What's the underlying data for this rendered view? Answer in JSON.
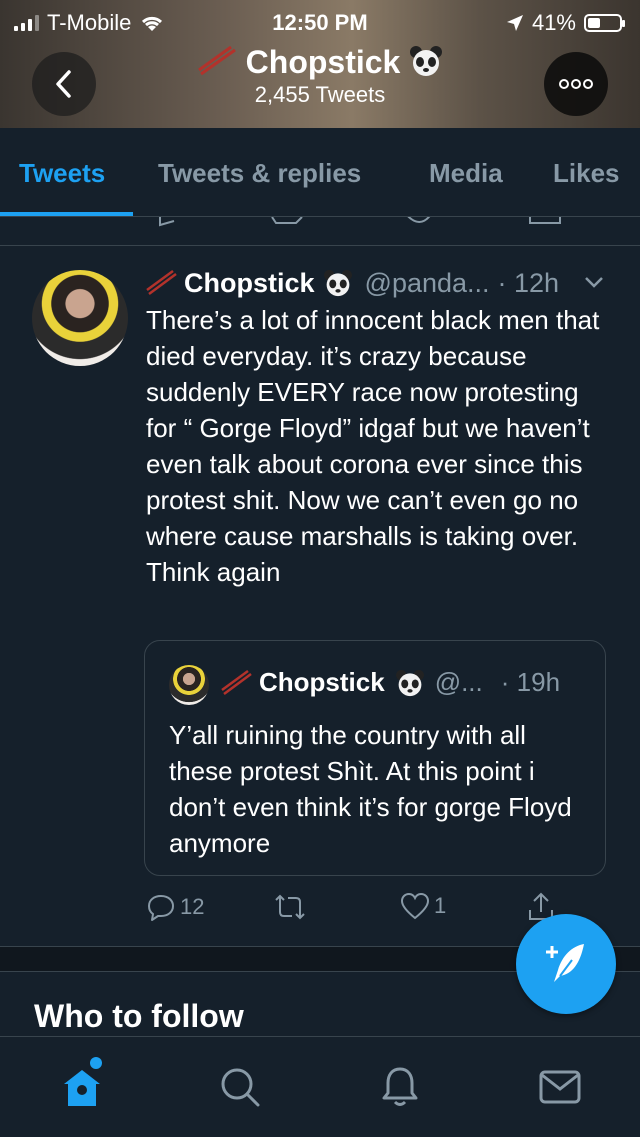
{
  "status_bar": {
    "carrier": "T-Mobile",
    "time": "12:50 PM",
    "battery_percent": "41%",
    "battery_level": 0.41
  },
  "header": {
    "title": "Chopstick",
    "tweet_count": "2,455 Tweets",
    "back_icon": "chevron-left-icon",
    "more_icon": "more-horizontal-icon"
  },
  "tabs": [
    {
      "label": "Tweets",
      "active": true
    },
    {
      "label": "Tweets & replies",
      "active": false
    },
    {
      "label": "Media",
      "active": false
    },
    {
      "label": "Likes",
      "active": false
    }
  ],
  "tweet": {
    "name": "Chopstick",
    "handle": "@panda...",
    "time": "· 12h",
    "text": "There’s a lot of innocent black men that died everyday. it’s crazy because suddenly EVERY race now protesting for “ Gorge Floyd” idgaf but we haven’t even talk about corona ever since this protest shit. Now we can’t even go no where cause marshalls is taking over. Think again",
    "quoted": {
      "name": "Chopstick",
      "handle": "@...",
      "time": "· 19h",
      "text": "Y’all ruining the country with all these protest Shìt. At this point i don’t even think it’s for gorge Floyd anymore"
    },
    "actions": {
      "replies": "12",
      "retweets": "",
      "likes": "1"
    }
  },
  "who_to_follow": "Who to follow",
  "colors": {
    "background": "#15202b",
    "accent": "#1da1f2",
    "muted_text": "#8899a6",
    "border": "#38444d"
  },
  "bottom_nav": [
    "home-icon",
    "search-icon",
    "bell-icon",
    "mail-icon"
  ]
}
